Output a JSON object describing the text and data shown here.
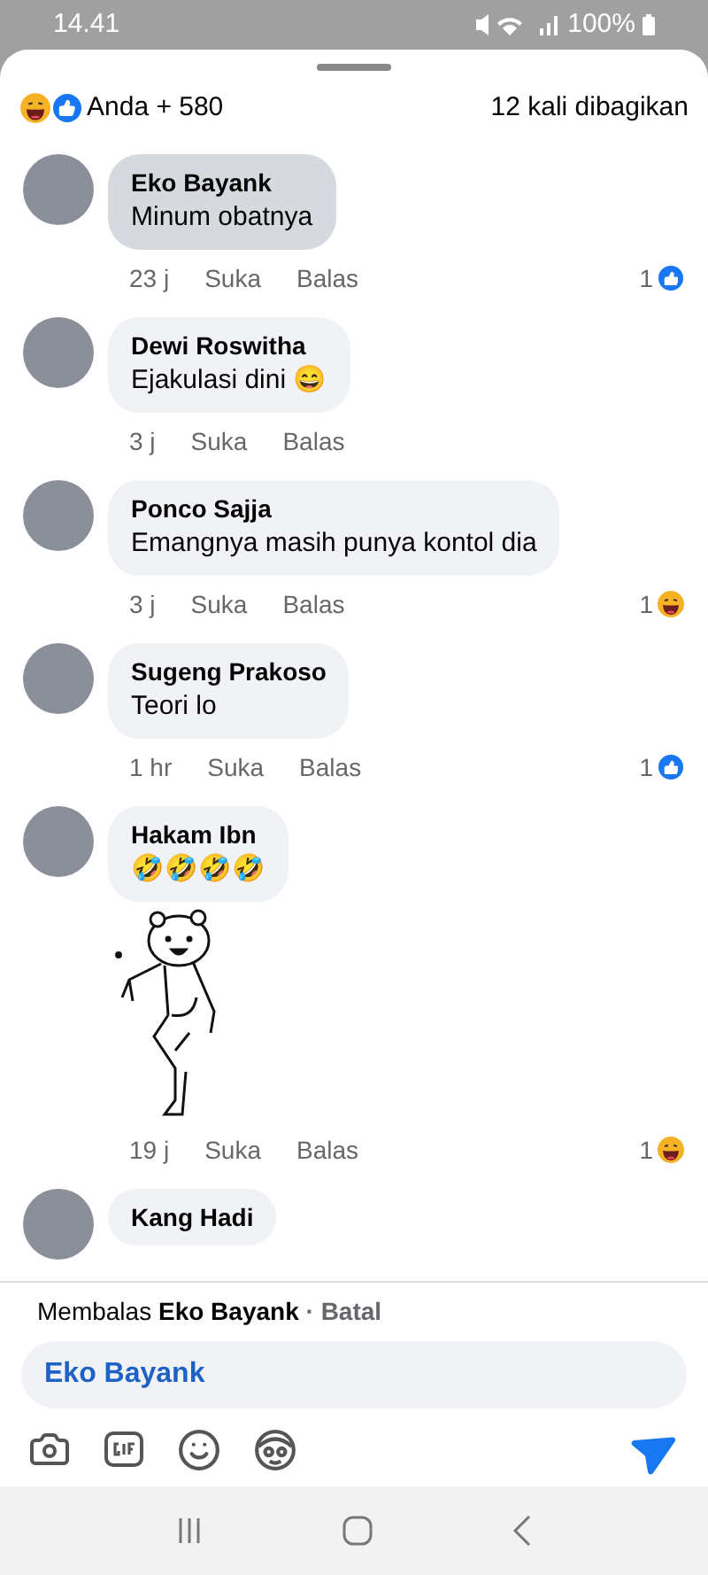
{
  "status_bar": {
    "time": "14.41",
    "battery": "100%"
  },
  "summary": {
    "reactions": [
      {
        "kind": "haha"
      },
      {
        "kind": "like"
      }
    ],
    "label": "Anda + 580",
    "shares": "12 kali dibagikan"
  },
  "comments": [
    {
      "name": "Eko Bayank",
      "text": "Minum obatnya",
      "selected": true,
      "time": "23 j",
      "like": "Suka",
      "reply": "Balas",
      "reaction": {
        "kind": "like",
        "count": "1"
      }
    },
    {
      "name": "Dewi Roswitha",
      "text": "Ejakulasi dini 😄",
      "selected": false,
      "time": "3 j",
      "like": "Suka",
      "reply": "Balas"
    },
    {
      "name": "Ponco Sajja",
      "text": "Emangnya masih punya kontol dia",
      "selected": false,
      "time": "3 j",
      "like": "Suka",
      "reply": "Balas",
      "reaction": {
        "kind": "haha",
        "count": "1"
      }
    },
    {
      "name": "Sugeng Prakoso",
      "text": "Teori lo",
      "selected": false,
      "time": "1 hr",
      "like": "Suka",
      "reply": "Balas",
      "reaction": {
        "kind": "like",
        "count": "1"
      }
    },
    {
      "name": "Hakam Ibn",
      "text": "🤣🤣🤣🤣",
      "selected": false,
      "sticker": true,
      "time": "19 j",
      "like": "Suka",
      "reply": "Balas",
      "reaction": {
        "kind": "haha",
        "count": "1"
      }
    },
    {
      "name": "Kang Hadi",
      "selected": false
    }
  ],
  "reply_bar": {
    "prefix": "Membalas",
    "target": "Eko Bayank",
    "separator": "·",
    "cancel": "Batal",
    "value": "Eko Bayank"
  }
}
